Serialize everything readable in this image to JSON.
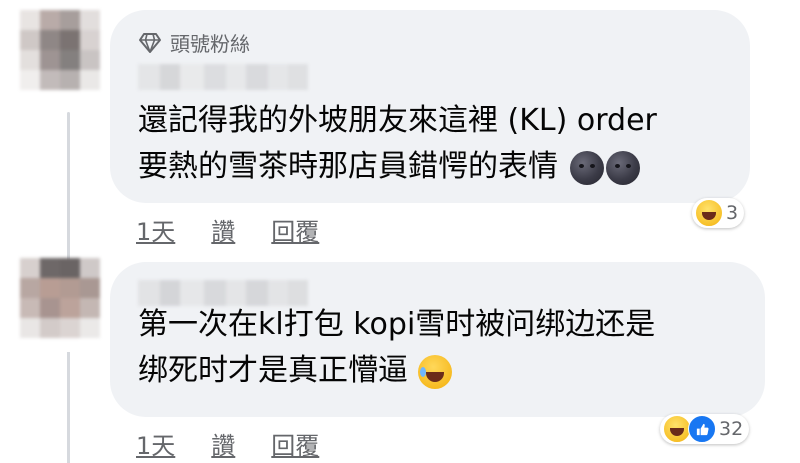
{
  "comments": [
    {
      "badge": "頭號粉絲",
      "badge_icon": "diamond-icon",
      "line1": "還記得我的外坡朋友來這裡 (KL) order",
      "line2": "要熱的雪茶時那店員錯愕的表情",
      "line2_emojis": [
        "new-moon-face",
        "new-moon-face"
      ],
      "reactions": [
        "haha"
      ],
      "reaction_count": "3",
      "actions": {
        "time": "1天",
        "like": "讚",
        "reply": "回覆"
      }
    },
    {
      "line1": "第一次在kl打包 kopi雪时被问绑边还是",
      "line2": "绑死时才是真正懵逼",
      "line2_emojis": [
        "face-with-tears-of-joy"
      ],
      "reactions": [
        "haha",
        "like"
      ],
      "reaction_count": "32",
      "actions": {
        "time": "1天",
        "like": "讚",
        "reply": "回覆"
      }
    }
  ],
  "colors": {
    "bubble": "#f0f2f5",
    "text": "#050505",
    "meta": "#65676b",
    "like_blue": "#1877f2"
  }
}
